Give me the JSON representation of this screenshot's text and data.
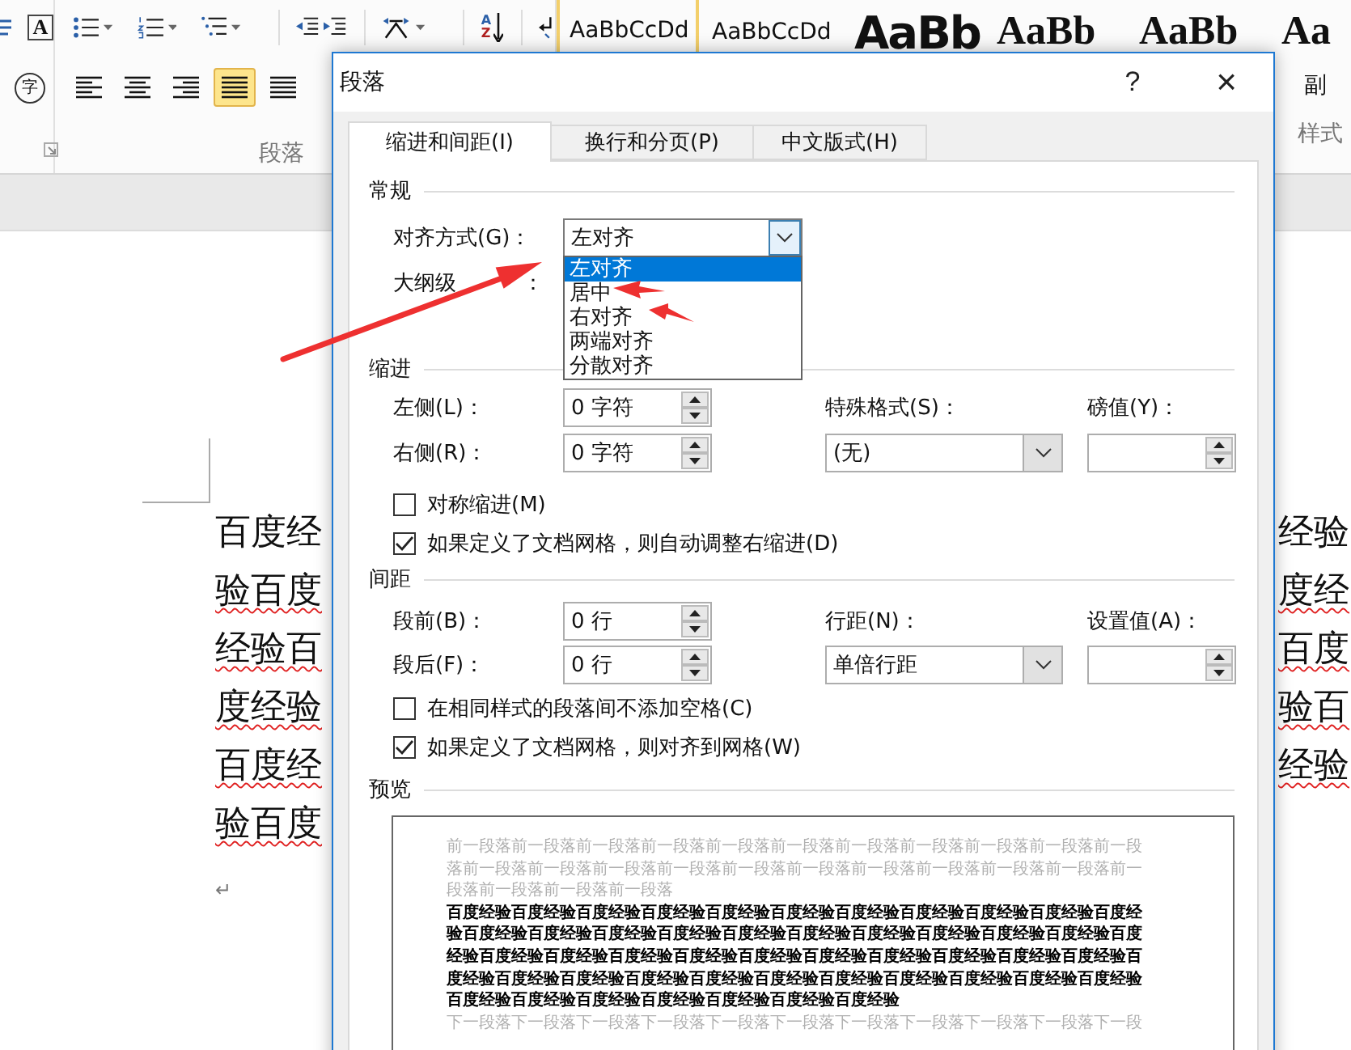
{
  "ribbon": {
    "font_group": {
      "border_char": "A",
      "enclosed_char": "字"
    },
    "paragraph_group": {
      "label": "段落",
      "sort_letters": [
        "A",
        "Z"
      ],
      "align_buttons": [
        {
          "selected": false
        },
        {
          "selected": false
        },
        {
          "selected": false
        },
        {
          "selected": true
        },
        {
          "selected": false
        }
      ]
    },
    "styles": [
      {
        "kind": "sans",
        "text": "AaBbCcDd",
        "selected": true
      },
      {
        "kind": "sans",
        "text": "AaBbCcDd",
        "selected": false
      },
      {
        "kind": "sans-bold",
        "text": "AaBb",
        "selected": false
      },
      {
        "kind": "serif-bold",
        "text": "AaBb",
        "selected": false
      },
      {
        "kind": "serif-bold",
        "text": "AaBb",
        "selected": false
      },
      {
        "kind": "serif-bold",
        "text": "Aa",
        "selected": false
      }
    ],
    "style_name": "副",
    "styles_label": "样式"
  },
  "document": {
    "lines": [
      {
        "left": "百度经",
        "right": "经验",
        "squiggle": false
      },
      {
        "left": "验百度",
        "right": "度经",
        "squiggle": true
      },
      {
        "left": "经验百",
        "right": "百度",
        "squiggle": true
      },
      {
        "left": "度经验",
        "right": "验百",
        "squiggle": true
      },
      {
        "left": "百度经",
        "right": "经验",
        "squiggle": true
      },
      {
        "left": "验百度",
        "squiggle": true
      }
    ],
    "paragraph_mark": "↵"
  },
  "dialog": {
    "title": "段落",
    "help": "?",
    "close": "×",
    "tabs": [
      {
        "label": "缩进和间距(I)",
        "selected": true
      },
      {
        "label": "换行和分页(P)",
        "selected": false
      },
      {
        "label": "中文版式(H)",
        "selected": false
      }
    ],
    "general": {
      "heading": "常规",
      "alignment": {
        "label": "对齐方式(G)：",
        "value": "左对齐",
        "expanded": true,
        "options": [
          {
            "label": "左对齐",
            "selected": true
          },
          {
            "label": "居中",
            "selected": false
          },
          {
            "label": "右对齐",
            "selected": false
          },
          {
            "label": "两端对齐",
            "selected": false
          },
          {
            "label": "分散对齐",
            "selected": false
          }
        ]
      },
      "outline_label": "大纲级",
      "outline_colon": "："
    },
    "indent": {
      "heading": "缩进",
      "left": {
        "label": "左侧(L)：",
        "value": "0 字符"
      },
      "right": {
        "label": "右侧(R)：",
        "value": "0 字符"
      },
      "special": {
        "label": "特殊格式(S)：",
        "value": "(无)"
      },
      "by_label": "磅值(Y)：",
      "checkboxes": [
        {
          "label": "对称缩进(M)",
          "checked": false
        },
        {
          "label": "如果定义了文档网格，则自动调整右缩进(D)",
          "checked": true
        }
      ]
    },
    "spacing": {
      "heading": "间距",
      "before": {
        "label": "段前(B)：",
        "value": "0 行"
      },
      "after": {
        "label": "段后(F)：",
        "value": "0 行"
      },
      "line_spacing": {
        "label": "行距(N)：",
        "value": "单倍行距"
      },
      "at_label": "设置值(A)：",
      "checkboxes": [
        {
          "label": "在相同样式的段落间不添加空格(C)",
          "checked": false
        },
        {
          "label": "如果定义了文档网格，则对齐到网格(W)",
          "checked": true
        }
      ]
    },
    "preview": {
      "heading": "预览",
      "lines": [
        {
          "kind": "previous",
          "text": "前一段落前一段落前一段落前一段落前一段落前一段落前一段落前一段落前一段落前一段落前一段"
        },
        {
          "kind": "previous",
          "text": "落前一段落前一段落前一段落前一段落前一段落前一段落前一段落前一段落前一段落前一段落前一"
        },
        {
          "kind": "previous",
          "text": "段落前一段落前一段落前一段落"
        },
        {
          "kind": "current",
          "text": "百度经验百度经验百度经验百度经验百度经验百度经验百度经验百度经验百度经验百度经验百度经"
        },
        {
          "kind": "current",
          "text": "验百度经验百度经验百度经验百度经验百度经验百度经验百度经验百度经验百度经验百度经验百度"
        },
        {
          "kind": "current",
          "text": "经验百度经验百度经验百度经验百度经验百度经验百度经验百度经验百度经验百度经验百度经验百"
        },
        {
          "kind": "current",
          "text": "度经验百度经验百度经验百度经验百度经验百度经验百度经验百度经验百度经验百度经验百度经验"
        },
        {
          "kind": "current",
          "text": "百度经验百度经验百度经验百度经验百度经验百度经验百度经验"
        },
        {
          "kind": "next",
          "text": "下一段落下一段落下一段落下一段落下一段落下一段落下一段落下一段落下一段落下一段落下一段"
        }
      ]
    }
  }
}
